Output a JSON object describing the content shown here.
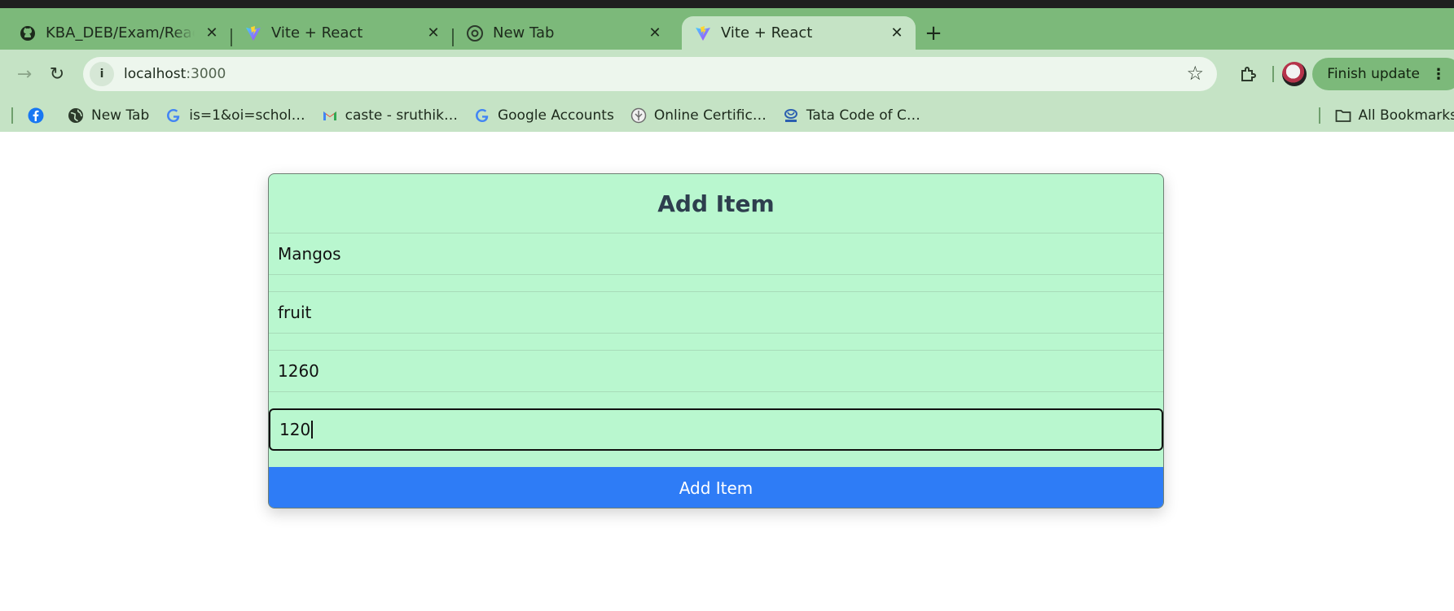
{
  "browser": {
    "tabs": [
      {
        "title": "KBA_DEB/Exam/ReactEx",
        "icon": "github-icon",
        "active": false
      },
      {
        "title": "Vite + React",
        "icon": "vite-icon",
        "active": false
      },
      {
        "title": "New Tab",
        "icon": "chrome-icon",
        "active": false
      },
      {
        "title": "Vite + React",
        "icon": "vite-icon",
        "active": true
      }
    ],
    "address": {
      "host": "localhost",
      "port": ":3000"
    },
    "finish_update_label": "Finish update",
    "bookmarks": [
      {
        "label": "",
        "icon": "facebook-icon"
      },
      {
        "label": "New Tab",
        "icon": "globe-icon"
      },
      {
        "label": "is=1&oi=schol…",
        "icon": "google-icon"
      },
      {
        "label": "caste - sruthik…",
        "icon": "gmail-icon"
      },
      {
        "label": "Google Accounts",
        "icon": "google-icon"
      },
      {
        "label": "Online Certific…",
        "icon": "certificate-icon"
      },
      {
        "label": "Tata Code of C…",
        "icon": "tata-icon"
      }
    ],
    "all_bookmarks_label": "All Bookmarks"
  },
  "form": {
    "title": "Add Item",
    "fields": [
      {
        "value": "Mangos"
      },
      {
        "value": "fruit"
      },
      {
        "value": "1260"
      },
      {
        "value": "120"
      }
    ],
    "submit_label": "Add Item"
  }
}
